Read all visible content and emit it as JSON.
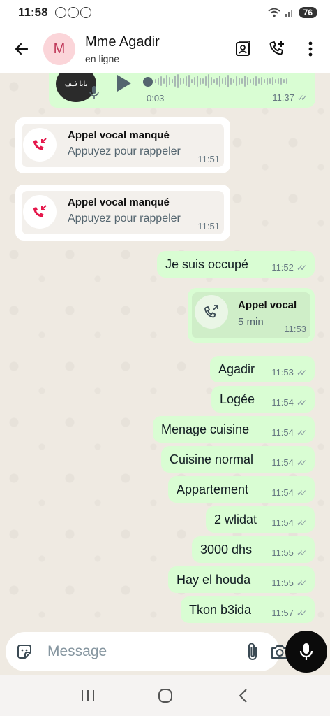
{
  "status_bar": {
    "time": "11:58",
    "battery": "76"
  },
  "header": {
    "avatar_initial": "M",
    "name": "Mme Agadir",
    "status": "en ligne"
  },
  "voice_note": {
    "thumb_text": "بابا فيف",
    "duration": "0:03",
    "time": "11:37"
  },
  "missed_calls": [
    {
      "title": "Appel vocal manqué",
      "subtitle": "Appuyez pour rappeler",
      "time": "11:51"
    },
    {
      "title": "Appel vocal manqué",
      "subtitle": "Appuyez pour rappeler",
      "time": "11:51"
    }
  ],
  "first_message": {
    "text": "Je suis occupé",
    "time": "11:52"
  },
  "voice_call": {
    "title": "Appel vocal",
    "duration": "5 min",
    "time": "11:53"
  },
  "messages": [
    {
      "text": "Agadir",
      "time": "11:53"
    },
    {
      "text": "Logée",
      "time": "11:54"
    },
    {
      "text": "Menage cuisine",
      "time": "11:54"
    },
    {
      "text": "Cuisine normal",
      "time": "11:54"
    },
    {
      "text": "Appartement",
      "time": "11:54"
    },
    {
      "text": "2 wlidat",
      "time": "11:54"
    },
    {
      "text": "3000 dhs",
      "time": "11:55"
    },
    {
      "text": "Hay el houda",
      "time": "11:55"
    },
    {
      "text": "Tkon b3ida",
      "time": "11:57"
    }
  ],
  "composer": {
    "placeholder": "Message"
  },
  "icons": {
    "back": "arrow-left-icon",
    "contact": "contact-card-icon",
    "add_call": "add-call-icon",
    "menu": "more-vert-icon",
    "sticker": "sticker-icon",
    "attach": "paperclip-icon",
    "camera": "camera-icon",
    "mic": "mic-icon",
    "missed": "missed-call-icon",
    "outgoing": "outgoing-call-icon",
    "read": "double-check-icon"
  },
  "colors": {
    "outgoing_bubble": "#d9fdd3",
    "incoming_bubble": "#ffffff",
    "missed_red": "#e5174b",
    "chat_bg": "#efeae2"
  }
}
